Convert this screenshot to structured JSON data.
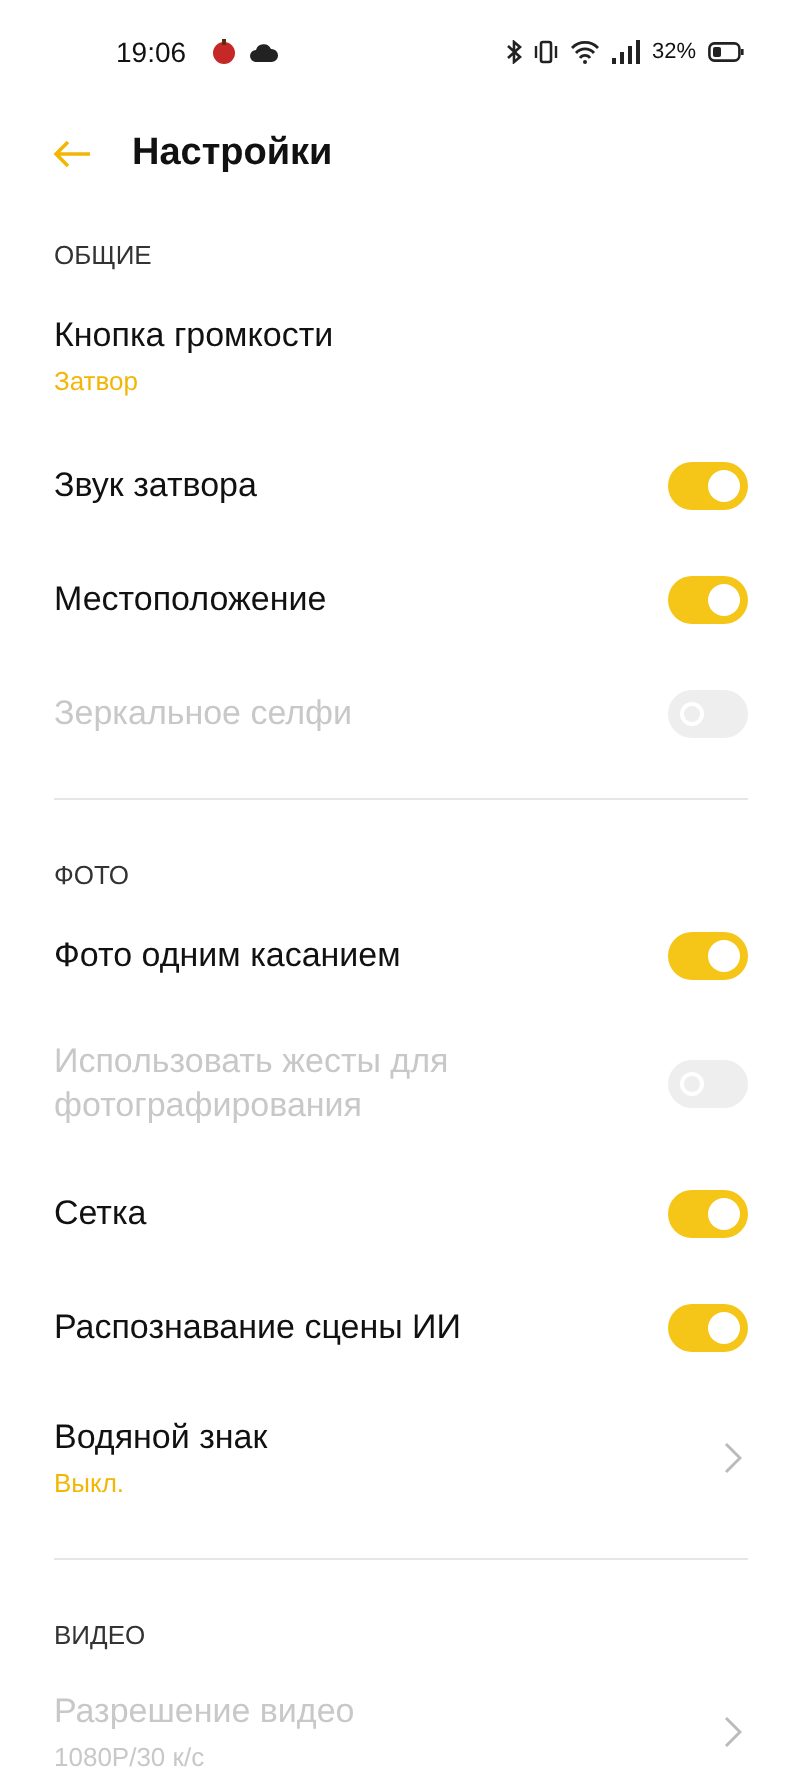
{
  "status_bar": {
    "time": "19:06",
    "battery": "32%"
  },
  "header": {
    "title": "Настройки"
  },
  "sections": [
    {
      "title": "ОБЩИЕ",
      "items": [
        {
          "kind": "link",
          "label": "Кнопка громкости",
          "value": "Затвор",
          "disabled": false,
          "chevron": false
        },
        {
          "kind": "toggle",
          "label": "Звук затвора",
          "on": true,
          "disabled": false
        },
        {
          "kind": "toggle",
          "label": "Местоположение",
          "on": true,
          "disabled": false
        },
        {
          "kind": "toggle",
          "label": "Зеркальное селфи",
          "on": false,
          "disabled": true
        }
      ]
    },
    {
      "title": "ФОТО",
      "items": [
        {
          "kind": "toggle",
          "label": "Фото одним касанием",
          "on": true,
          "disabled": false
        },
        {
          "kind": "toggle",
          "label": "Использовать жесты для фотографирования",
          "on": false,
          "disabled": true
        },
        {
          "kind": "toggle",
          "label": "Сетка",
          "on": true,
          "disabled": false
        },
        {
          "kind": "toggle",
          "label": "Распознавание сцены ИИ",
          "on": true,
          "disabled": false
        },
        {
          "kind": "link",
          "label": "Водяной знак",
          "value": "Выкл.",
          "disabled": false,
          "chevron": true
        }
      ]
    },
    {
      "title": "ВИДЕО",
      "items": [
        {
          "kind": "link",
          "label": "Разрешение видео",
          "value": "1080P/30 к/с",
          "disabled": true,
          "chevron": true
        }
      ]
    }
  ]
}
